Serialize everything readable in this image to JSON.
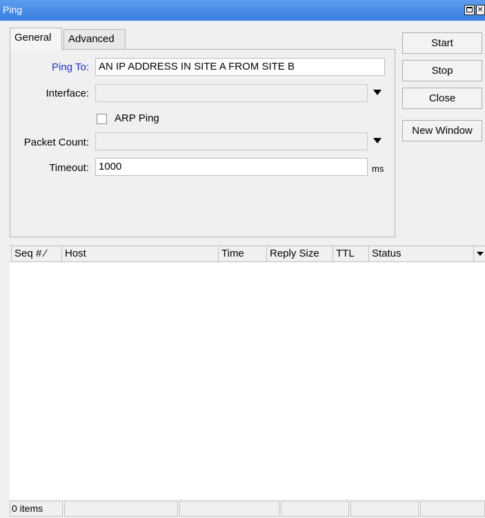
{
  "window": {
    "title": "Ping"
  },
  "tabs": [
    {
      "label": "General"
    },
    {
      "label": "Advanced"
    }
  ],
  "form": {
    "ping_to": {
      "label": "Ping To:",
      "value": "AN IP ADDRESS IN SITE A FROM SITE B"
    },
    "interface": {
      "label": "Interface:",
      "value": ""
    },
    "arp_ping": {
      "label": "ARP Ping",
      "checked": false
    },
    "packet_count": {
      "label": "Packet Count:",
      "value": ""
    },
    "timeout": {
      "label": "Timeout:",
      "value": "1000",
      "unit": "ms"
    }
  },
  "buttons": {
    "start": "Start",
    "stop": "Stop",
    "close": "Close",
    "new_window": "New Window"
  },
  "table": {
    "columns": [
      "Seq # ∕",
      "Host",
      "Time",
      "Reply Size",
      "TTL",
      "Status"
    ]
  },
  "status": {
    "items": "0 items"
  }
}
